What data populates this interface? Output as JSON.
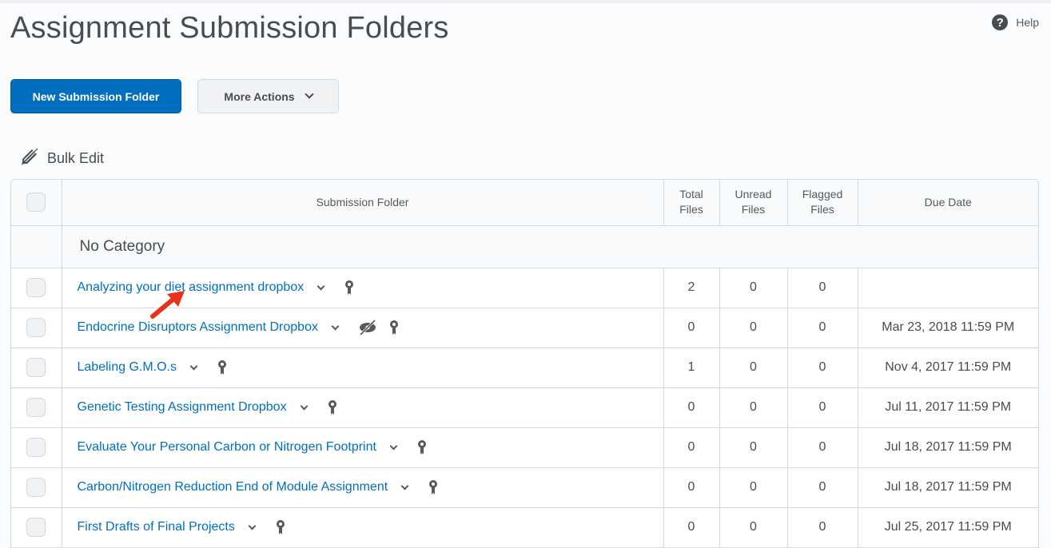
{
  "page": {
    "title": "Assignment Submission Folders",
    "help_label": "Help"
  },
  "toolbar": {
    "new_folder_label": "New Submission Folder",
    "more_actions_label": "More Actions",
    "bulk_edit_label": "Bulk Edit"
  },
  "colors": {
    "primary": "#006fbf",
    "link": "#006fbf",
    "border": "#d3d9e3",
    "text": "#494c4e",
    "annotation_arrow": "#e8321c"
  },
  "table": {
    "columns": [
      "Submission Folder",
      "Total Files",
      "Unread Files",
      "Flagged Files",
      "Due Date"
    ],
    "columns_split": {
      "total": [
        "Total",
        "Files"
      ],
      "unread": [
        "Unread",
        "Files"
      ],
      "flagged": [
        "Flagged",
        "Files"
      ]
    },
    "category": "No Category",
    "rows": [
      {
        "name": "Analyzing your diet assignment dropbox",
        "hidden": false,
        "total": "2",
        "unread": "0",
        "flagged": "0",
        "due": ""
      },
      {
        "name": "Endocrine Disruptors Assignment Dropbox",
        "hidden": true,
        "total": "0",
        "unread": "0",
        "flagged": "0",
        "due": "Mar 23, 2018 11:59 PM"
      },
      {
        "name": "Labeling G.M.O.s",
        "hidden": false,
        "total": "1",
        "unread": "0",
        "flagged": "0",
        "due": "Nov 4, 2017 11:59 PM"
      },
      {
        "name": "Genetic Testing Assignment Dropbox",
        "hidden": false,
        "total": "0",
        "unread": "0",
        "flagged": "0",
        "due": "Jul 11, 2017 11:59 PM"
      },
      {
        "name": "Evaluate Your Personal Carbon or Nitrogen Footprint",
        "hidden": false,
        "total": "0",
        "unread": "0",
        "flagged": "0",
        "due": "Jul 18, 2017 11:59 PM"
      },
      {
        "name": "Carbon/Nitrogen Reduction End of Module Assignment",
        "hidden": false,
        "total": "0",
        "unread": "0",
        "flagged": "0",
        "due": "Jul 18, 2017 11:59 PM"
      },
      {
        "name": "First Drafts of Final Projects",
        "hidden": false,
        "total": "0",
        "unread": "0",
        "flagged": "0",
        "due": "Jul 25, 2017 11:59 PM"
      }
    ]
  }
}
